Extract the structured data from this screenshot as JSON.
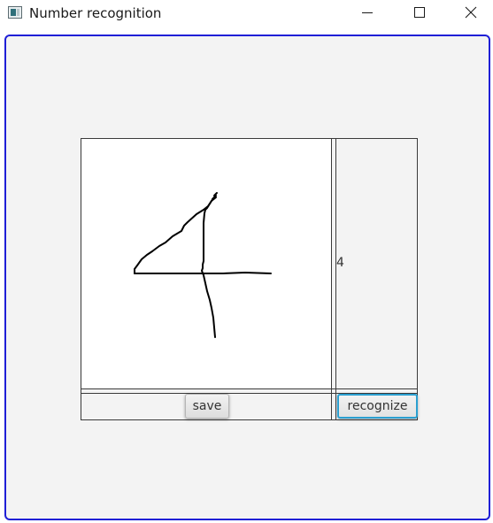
{
  "window": {
    "title": "Number recognition",
    "icon": "app-window-icon",
    "controls": {
      "minimize_icon": "minimize-icon",
      "maximize_icon": "maximize-icon",
      "close_icon": "close-icon"
    },
    "focus_border_color": "#1f1fd6"
  },
  "drawing_canvas": {
    "background": "#ffffff",
    "stroke_color": "#000000",
    "drawn_content": "handwritten digit 4"
  },
  "result": {
    "label": "4"
  },
  "buttons": {
    "save_label": "save",
    "recognize_label": "recognize",
    "recognize_focus_color": "#2a9fd0"
  }
}
